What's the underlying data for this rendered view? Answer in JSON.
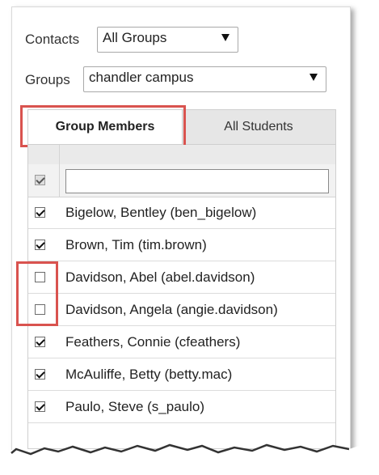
{
  "contacts": {
    "label": "Contacts",
    "selected": "All Groups"
  },
  "groups": {
    "label": "Groups",
    "selected": "chandler campus"
  },
  "tabs": [
    {
      "label": "Group Members",
      "active": true
    },
    {
      "label": "All Students",
      "active": false
    }
  ],
  "select_all_checked": true,
  "filter": {
    "value": ""
  },
  "members": [
    {
      "label": "Bigelow, Bentley (ben_bigelow)",
      "checked": true
    },
    {
      "label": "Brown, Tim (tim.brown)",
      "checked": true
    },
    {
      "label": "Davidson, Abel (abel.davidson)",
      "checked": false
    },
    {
      "label": "Davidson, Angela (angie.davidson)",
      "checked": false
    },
    {
      "label": "Feathers, Connie (cfeathers)",
      "checked": true
    },
    {
      "label": "McAuliffe, Betty (betty.mac)",
      "checked": true
    },
    {
      "label": "Paulo, Steve (s_paulo)",
      "checked": true
    }
  ],
  "colors": {
    "highlight": "#d9534f",
    "tab_bar": "#e6e6e6"
  }
}
